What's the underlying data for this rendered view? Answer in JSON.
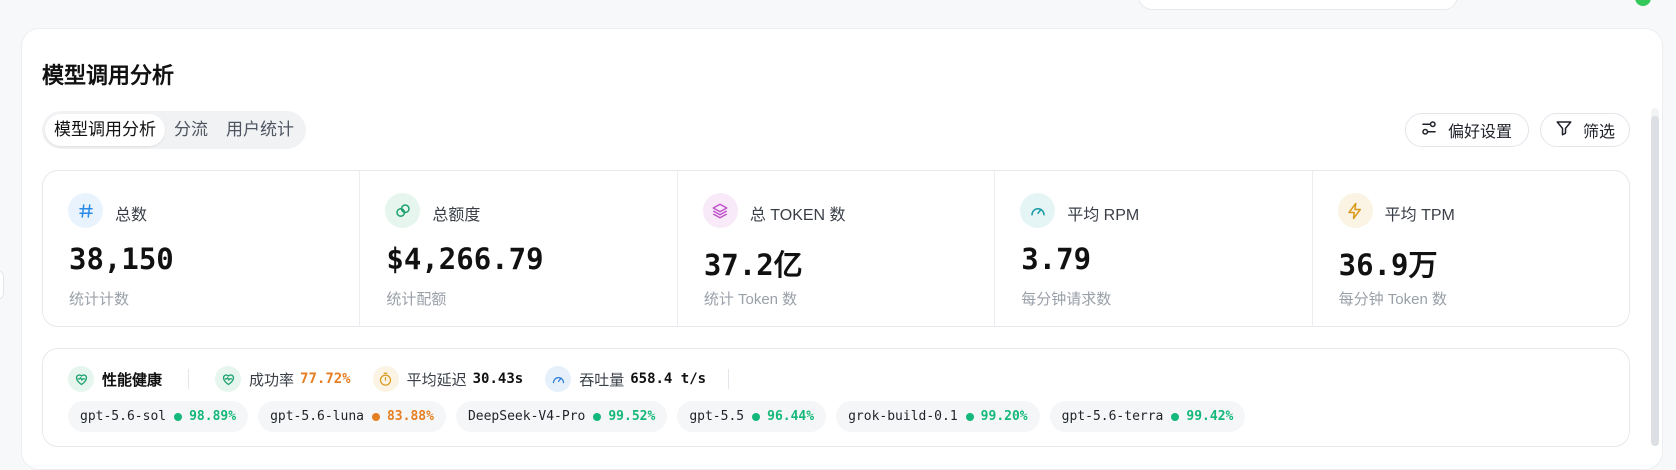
{
  "page": {
    "title": "模型调用分析"
  },
  "tabs": [
    {
      "label": "模型调用分析",
      "active": true
    },
    {
      "label": "分流",
      "active": false
    },
    {
      "label": "用户统计",
      "active": false
    }
  ],
  "toolbar": {
    "preferences_label": "偏好设置",
    "filter_label": "筛选"
  },
  "stats": [
    {
      "icon": "hash-icon",
      "label": "总数",
      "value": "38,150",
      "sub": "统计计数",
      "color": "#2b8be6",
      "bg": "#e8f3fd"
    },
    {
      "icon": "coins-icon",
      "label": "总额度",
      "value": "$4,266.79",
      "sub": "统计配额",
      "color": "#1aa06d",
      "bg": "#e6f6ef"
    },
    {
      "icon": "layers-icon",
      "label": "总 TOKEN 数",
      "value": "37.2亿",
      "sub": "统计 Token 数",
      "color": "#c052c9",
      "bg": "#f8eaf9"
    },
    {
      "icon": "gauge-icon",
      "label": "平均 RPM",
      "value": "3.79",
      "sub": "每分钟请求数",
      "color": "#1a9aa6",
      "bg": "#e5f5f6"
    },
    {
      "icon": "bolt-icon",
      "label": "平均 TPM",
      "value": "36.9万",
      "sub": "每分钟 Token 数",
      "color": "#d99a1e",
      "bg": "#fbf3e3"
    }
  ],
  "health": {
    "title": "性能健康",
    "success_rate_label": "成功率",
    "success_rate_value": "77.72%",
    "latency_label": "平均延迟",
    "latency_value": "30.43s",
    "throughput_label": "吞吐量",
    "throughput_value": "658.4 t/s",
    "models": [
      {
        "name": "gpt-5.6-sol",
        "pct": "98.89%",
        "color": "#14b87a"
      },
      {
        "name": "gpt-5.6-luna",
        "pct": "83.88%",
        "color": "#e67e22"
      },
      {
        "name": "DeepSeek-V4-Pro",
        "pct": "99.52%",
        "color": "#14b87a"
      },
      {
        "name": "gpt-5.5",
        "pct": "96.44%",
        "color": "#14b87a"
      },
      {
        "name": "grok-build-0.1",
        "pct": "99.20%",
        "color": "#14b87a"
      },
      {
        "name": "gpt-5.6-terra",
        "pct": "99.42%",
        "color": "#14b87a"
      }
    ]
  }
}
